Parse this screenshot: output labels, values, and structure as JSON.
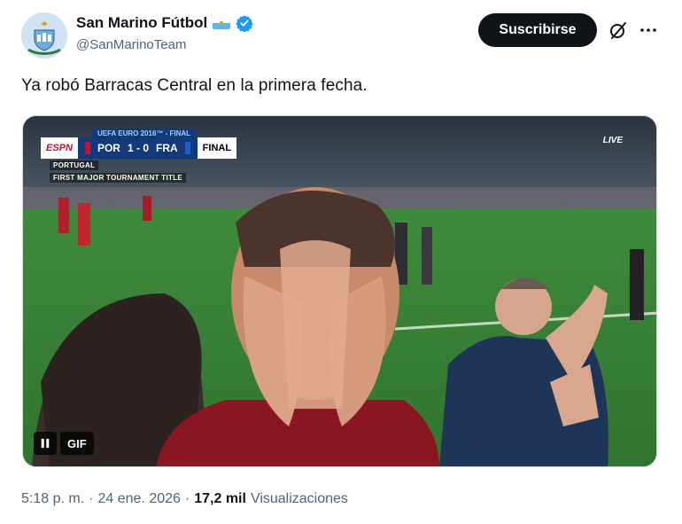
{
  "author": {
    "display_name": "San Marino Fútbol",
    "handle": "@SanMarinoTeam",
    "avatar_icon": "san-marino-crest-icon",
    "flag_icon": "san-marino-flag-icon",
    "verified_icon": "verified-badge-icon",
    "verified_color": "#1d9bf0"
  },
  "actions": {
    "subscribe_label": "Suscribirse",
    "grok_icon": "grok-icon",
    "more_icon": "more-options-icon"
  },
  "tweet": {
    "text": "Ya robó Barracas Central en la primera fecha."
  },
  "media": {
    "type": "gif",
    "gif_label": "GIF",
    "pause_icon": "pause-icon",
    "scorebug": {
      "network": "ESPN",
      "header": "UEFA EURO 2016™ - FINAL",
      "home_team": "POR",
      "away_team": "FRA",
      "score": "1 - 0",
      "status": "FINAL",
      "line1": "PORTUGAL",
      "line2": "FIRST MAJOR TOURNAMENT TITLE",
      "live": "LIVE"
    }
  },
  "meta": {
    "time": "5:18 p. m.",
    "separator": "·",
    "date": "24 ene. 2026",
    "views_count": "17,2 mil",
    "views_label": "Visualizaciones"
  },
  "colors": {
    "text_primary": "#0f1419",
    "text_secondary": "#536471",
    "button_bg": "#0f1419",
    "border": "#cfd9de"
  }
}
